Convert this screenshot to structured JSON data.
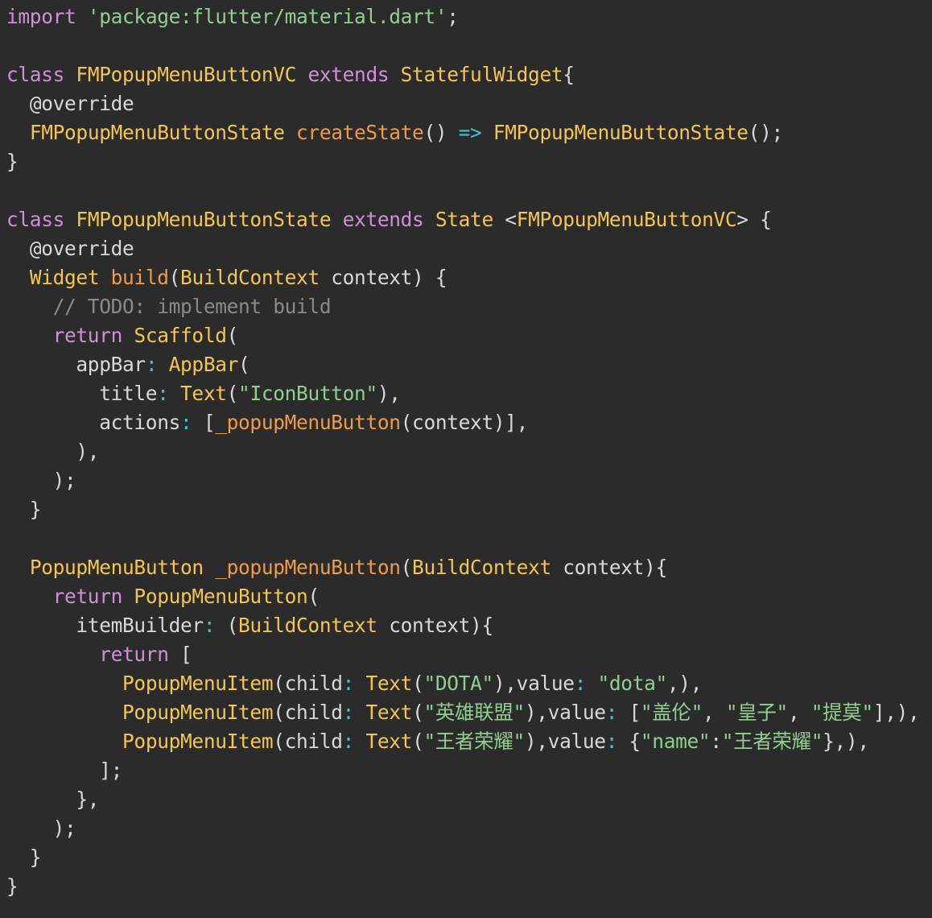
{
  "colors": {
    "background": "#2b2b2b",
    "kw": "#d08fd8",
    "type": "#f3c456",
    "fn": "#ef9b4b",
    "str": "#8fcf8f",
    "op": "#42c3d0",
    "cm": "#8a8a8a",
    "pl": "#d8d8d8",
    "an": "#d8d8d8"
  },
  "code": {
    "lines": [
      [
        [
          "kw",
          "import"
        ],
        [
          "pl",
          " "
        ],
        [
          "str",
          "'package:flutter/material.dart'"
        ],
        [
          "pl",
          ";"
        ]
      ],
      [],
      [
        [
          "kw",
          "class"
        ],
        [
          "pl",
          " "
        ],
        [
          "type",
          "FMPopupMenuButtonVC"
        ],
        [
          "pl",
          " "
        ],
        [
          "kw",
          "extends"
        ],
        [
          "pl",
          " "
        ],
        [
          "type",
          "StatefulWidget"
        ],
        [
          "pl",
          "{"
        ]
      ],
      [
        [
          "pl",
          "  "
        ],
        [
          "an",
          "@override"
        ]
      ],
      [
        [
          "pl",
          "  "
        ],
        [
          "type",
          "FMPopupMenuButtonState"
        ],
        [
          "pl",
          " "
        ],
        [
          "fn",
          "createState"
        ],
        [
          "pl",
          "() "
        ],
        [
          "op",
          "=>"
        ],
        [
          "pl",
          " "
        ],
        [
          "type",
          "FMPopupMenuButtonState"
        ],
        [
          "pl",
          "();"
        ]
      ],
      [
        [
          "pl",
          "}"
        ]
      ],
      [],
      [
        [
          "kw",
          "class"
        ],
        [
          "pl",
          " "
        ],
        [
          "type",
          "FMPopupMenuButtonState"
        ],
        [
          "pl",
          " "
        ],
        [
          "kw",
          "extends"
        ],
        [
          "pl",
          " "
        ],
        [
          "type",
          "State"
        ],
        [
          "pl",
          " <"
        ],
        [
          "type",
          "FMPopupMenuButtonVC"
        ],
        [
          "pl",
          "> {"
        ]
      ],
      [
        [
          "pl",
          "  "
        ],
        [
          "an",
          "@override"
        ]
      ],
      [
        [
          "pl",
          "  "
        ],
        [
          "type",
          "Widget"
        ],
        [
          "pl",
          " "
        ],
        [
          "fn",
          "build"
        ],
        [
          "pl",
          "("
        ],
        [
          "type",
          "BuildContext"
        ],
        [
          "pl",
          " context) {"
        ]
      ],
      [
        [
          "pl",
          "    "
        ],
        [
          "cm",
          "// TODO: implement build"
        ]
      ],
      [
        [
          "pl",
          "    "
        ],
        [
          "kw",
          "return"
        ],
        [
          "pl",
          " "
        ],
        [
          "type",
          "Scaffold"
        ],
        [
          "pl",
          "("
        ]
      ],
      [
        [
          "pl",
          "      appBar"
        ],
        [
          "op",
          ":"
        ],
        [
          "pl",
          " "
        ],
        [
          "type",
          "AppBar"
        ],
        [
          "pl",
          "("
        ]
      ],
      [
        [
          "pl",
          "        title"
        ],
        [
          "op",
          ":"
        ],
        [
          "pl",
          " "
        ],
        [
          "type",
          "Text"
        ],
        [
          "pl",
          "("
        ],
        [
          "str",
          "\"IconButton\""
        ],
        [
          "pl",
          "),"
        ]
      ],
      [
        [
          "pl",
          "        actions"
        ],
        [
          "op",
          ":"
        ],
        [
          "pl",
          " ["
        ],
        [
          "fn",
          "_popupMenuButton"
        ],
        [
          "pl",
          "(context)],"
        ]
      ],
      [
        [
          "pl",
          "      ),"
        ]
      ],
      [
        [
          "pl",
          "    );"
        ]
      ],
      [
        [
          "pl",
          "  }"
        ]
      ],
      [],
      [
        [
          "pl",
          "  "
        ],
        [
          "type",
          "PopupMenuButton"
        ],
        [
          "pl",
          " "
        ],
        [
          "fn",
          "_popupMenuButton"
        ],
        [
          "pl",
          "("
        ],
        [
          "type",
          "BuildContext"
        ],
        [
          "pl",
          " context){"
        ]
      ],
      [
        [
          "pl",
          "    "
        ],
        [
          "kw",
          "return"
        ],
        [
          "pl",
          " "
        ],
        [
          "type",
          "PopupMenuButton"
        ],
        [
          "pl",
          "("
        ]
      ],
      [
        [
          "pl",
          "      itemBuilder"
        ],
        [
          "op",
          ":"
        ],
        [
          "pl",
          " ("
        ],
        [
          "type",
          "BuildContext"
        ],
        [
          "pl",
          " context){"
        ]
      ],
      [
        [
          "pl",
          "        "
        ],
        [
          "kw",
          "return"
        ],
        [
          "pl",
          " ["
        ]
      ],
      [
        [
          "pl",
          "          "
        ],
        [
          "type",
          "PopupMenuItem"
        ],
        [
          "pl",
          "(child"
        ],
        [
          "op",
          ":"
        ],
        [
          "pl",
          " "
        ],
        [
          "type",
          "Text"
        ],
        [
          "pl",
          "("
        ],
        [
          "str",
          "\"DOTA\""
        ],
        [
          "pl",
          "),value"
        ],
        [
          "op",
          ":"
        ],
        [
          "pl",
          " "
        ],
        [
          "str",
          "\"dota\""
        ],
        [
          "pl",
          ",),"
        ]
      ],
      [
        [
          "pl",
          "          "
        ],
        [
          "type",
          "PopupMenuItem"
        ],
        [
          "pl",
          "(child"
        ],
        [
          "op",
          ":"
        ],
        [
          "pl",
          " "
        ],
        [
          "type",
          "Text"
        ],
        [
          "pl",
          "("
        ],
        [
          "str",
          "\"英雄联盟\""
        ],
        [
          "pl",
          "),value"
        ],
        [
          "op",
          ":"
        ],
        [
          "pl",
          " ["
        ],
        [
          "str",
          "\"盖伦\""
        ],
        [
          "pl",
          ", "
        ],
        [
          "str",
          "\"皇子\""
        ],
        [
          "pl",
          ", "
        ],
        [
          "str",
          "\"提莫\""
        ],
        [
          "pl",
          "],),"
        ]
      ],
      [
        [
          "pl",
          "          "
        ],
        [
          "type",
          "PopupMenuItem"
        ],
        [
          "pl",
          "(child"
        ],
        [
          "op",
          ":"
        ],
        [
          "pl",
          " "
        ],
        [
          "type",
          "Text"
        ],
        [
          "pl",
          "("
        ],
        [
          "str",
          "\"王者荣耀\""
        ],
        [
          "pl",
          "),value"
        ],
        [
          "op",
          ":"
        ],
        [
          "pl",
          " {"
        ],
        [
          "str",
          "\"name\""
        ],
        [
          "pl",
          ":"
        ],
        [
          "str",
          "\"王者荣耀\""
        ],
        [
          "pl",
          "},),"
        ]
      ],
      [
        [
          "pl",
          "        ];"
        ]
      ],
      [
        [
          "pl",
          "      },"
        ]
      ],
      [
        [
          "pl",
          "    );"
        ]
      ],
      [
        [
          "pl",
          "  }"
        ]
      ],
      [
        [
          "pl",
          "}"
        ]
      ]
    ]
  }
}
